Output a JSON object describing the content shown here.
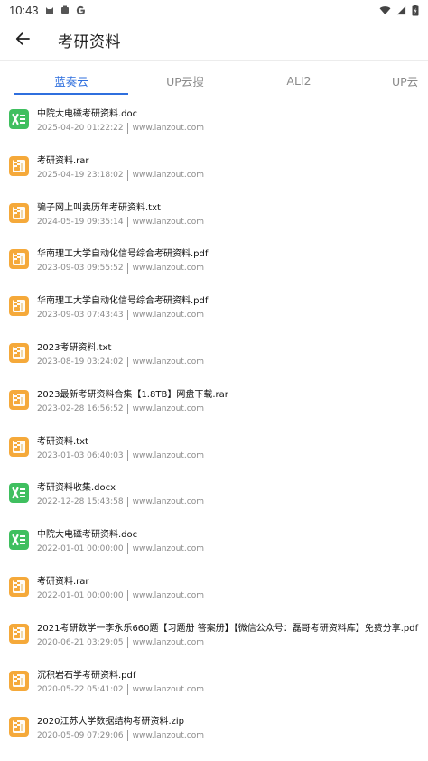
{
  "status_bar": {
    "time": "10:43"
  },
  "header": {
    "title": "考研资料"
  },
  "tabs": [
    {
      "label": "蓝奏云"
    },
    {
      "label": "UP云搜"
    },
    {
      "label": "ALI2"
    },
    {
      "label": "UP云"
    }
  ],
  "files": [
    {
      "name": "中院大电磁考研资料.doc",
      "date": "2025-04-20 01:22:22",
      "source": "www.lanzout.com",
      "type": "excel"
    },
    {
      "name": "考研资料.rar",
      "date": "2025-04-19 23:18:02",
      "source": "www.lanzout.com",
      "type": "archive"
    },
    {
      "name": "骗子网上叫卖历年考研资料.txt",
      "date": "2024-05-19 09:35:14",
      "source": "www.lanzout.com",
      "type": "archive"
    },
    {
      "name": "华南理工大学自动化信号综合考研资料.pdf",
      "date": "2023-09-03 09:55:52",
      "source": "www.lanzout.com",
      "type": "archive"
    },
    {
      "name": "华南理工大学自动化信号综合考研资料.pdf",
      "date": "2023-09-03 07:43:43",
      "source": "www.lanzout.com",
      "type": "archive"
    },
    {
      "name": "2023考研资料.txt",
      "date": "2023-08-19 03:24:02",
      "source": "www.lanzout.com",
      "type": "archive"
    },
    {
      "name": "2023最新考研资料合集【1.8TB】网盘下载.rar",
      "date": "2023-02-28 16:56:52",
      "source": "www.lanzout.com",
      "type": "archive"
    },
    {
      "name": "考研资料.txt",
      "date": "2023-01-03 06:40:03",
      "source": "www.lanzout.com",
      "type": "archive"
    },
    {
      "name": "考研资料收集.docx",
      "date": "2022-12-28 15:43:58",
      "source": "www.lanzout.com",
      "type": "excel"
    },
    {
      "name": "中院大电磁考研资料.doc",
      "date": "2022-01-01 00:00:00",
      "source": "www.lanzout.com",
      "type": "excel"
    },
    {
      "name": "考研资料.rar",
      "date": "2022-01-01 00:00:00",
      "source": "www.lanzout.com",
      "type": "archive"
    },
    {
      "name": "2021考研数学一李永乐660题【习题册 答案册】【微信公众号：磊哥考研资料库】免费分享.pdf",
      "date": "2020-06-21 03:29:05",
      "source": "www.lanzout.com",
      "type": "archive"
    },
    {
      "name": "沉积岩石学考研资料.pdf",
      "date": "2020-05-22 05:41:02",
      "source": "www.lanzout.com",
      "type": "archive"
    },
    {
      "name": "2020江苏大学数据结构考研资料.zip",
      "date": "2020-05-09 07:29:06",
      "source": "www.lanzout.com",
      "type": "archive"
    }
  ],
  "colors": {
    "accent": "#2f6fde",
    "excel_icon": "#3fbf5f",
    "archive_icon": "#f5a93a"
  }
}
